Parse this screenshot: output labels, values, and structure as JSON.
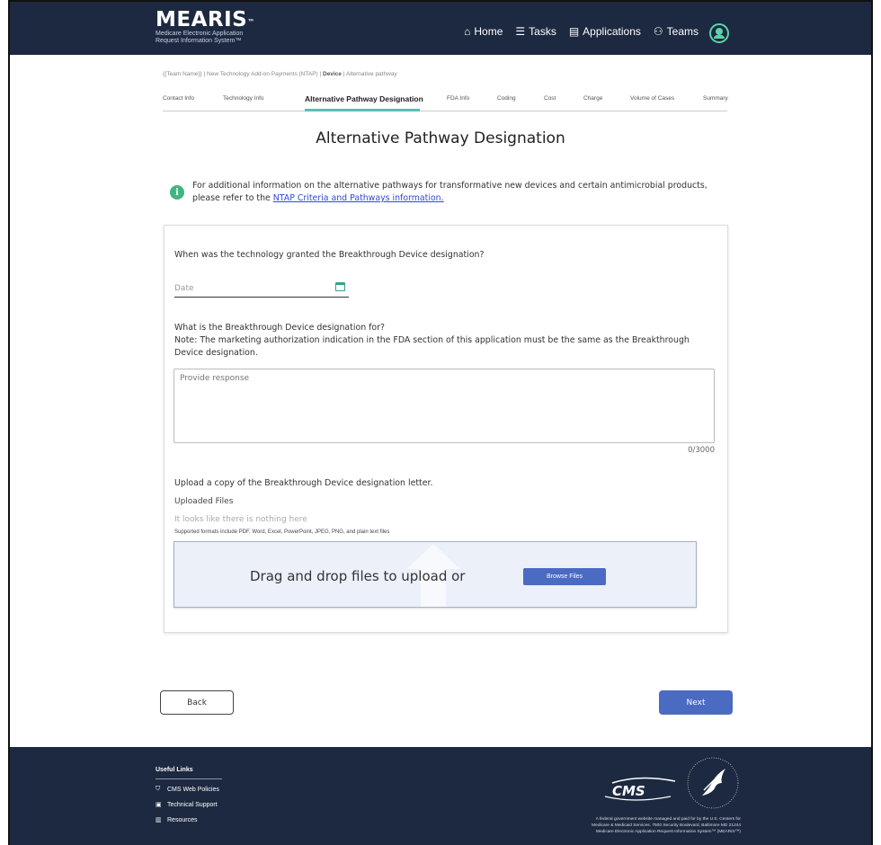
{
  "header": {
    "logo_name": "MEARIS",
    "logo_tm": "™",
    "logo_sub1": "Medicare Electronic Application",
    "logo_sub2": "Request Information System™",
    "nav": [
      {
        "label": "Home",
        "icon": "home-icon"
      },
      {
        "label": "Tasks",
        "icon": "tasks-icon"
      },
      {
        "label": "Applications",
        "icon": "clipboard-icon"
      },
      {
        "label": "Teams",
        "icon": "teams-icon"
      }
    ]
  },
  "breadcrumb": {
    "prefix": "{{Team Name}} | New Technology Add-on Payments (NTAP) | ",
    "bold": "Device",
    "suffix": " | Alternative pathway"
  },
  "steps": [
    {
      "label": "Contact Info"
    },
    {
      "label": "Technology Info"
    },
    {
      "label": "Alternative Pathway Designation",
      "active": true
    },
    {
      "label": "FDA Info"
    },
    {
      "label": "Coding"
    },
    {
      "label": "Cost"
    },
    {
      "label": "Charge"
    },
    {
      "label": "Volume of Cases"
    },
    {
      "label": "Summary"
    }
  ],
  "page_title": "Alternative Pathway Designation",
  "info": {
    "text": "For additional information on the alternative pathways for transformative new devices and certain antimicrobial products, please refer to the ",
    "link": "NTAP Criteria and Pathways information."
  },
  "form": {
    "q1": "When was the technology granted the Breakthrough Device designation?",
    "date_placeholder": "Date",
    "q2_line1": "What is the Breakthrough Device designation for?",
    "q2_line2": "Note: The marketing authorization indication in the FDA section of this application must be the same as the Breakthrough Device designation.",
    "response_placeholder": "Provide response",
    "char_count": "0/3000",
    "upload_label": "Upload a copy of the Breakthrough Device designation letter.",
    "uploaded_files": "Uploaded Files",
    "empty_text": "It looks like there is nothing here",
    "formats": "Supported formats include PDF, Word, Excel, PowerPoint, JPEG, PNG, and plain text files",
    "drop_text": "Drag and drop files to upload or",
    "browse_label": "Browse Files"
  },
  "buttons": {
    "back": "Back",
    "next": "Next"
  },
  "footer": {
    "useful_links": "Useful Links",
    "links": [
      {
        "label": "CMS Web Policies",
        "icon": "shield-icon"
      },
      {
        "label": "Technical Support",
        "icon": "support-icon"
      },
      {
        "label": "Resources",
        "icon": "books-icon"
      }
    ],
    "cms_logo": "CMS",
    "disclaimer1": "A federal government website managed and paid for by the U.S. Centers for",
    "disclaimer2": "Medicare & Medicaid Services. 7500 Security Boulevard, Baltimore MD 21244",
    "disclaimer3": "Medicare Electronic Application Request Information System™ (MEARIS™)"
  },
  "colors": {
    "navy": "#1d2940",
    "accent": "#4b6ac2",
    "teal": "#5cbdb3",
    "info_green": "#43b383"
  }
}
